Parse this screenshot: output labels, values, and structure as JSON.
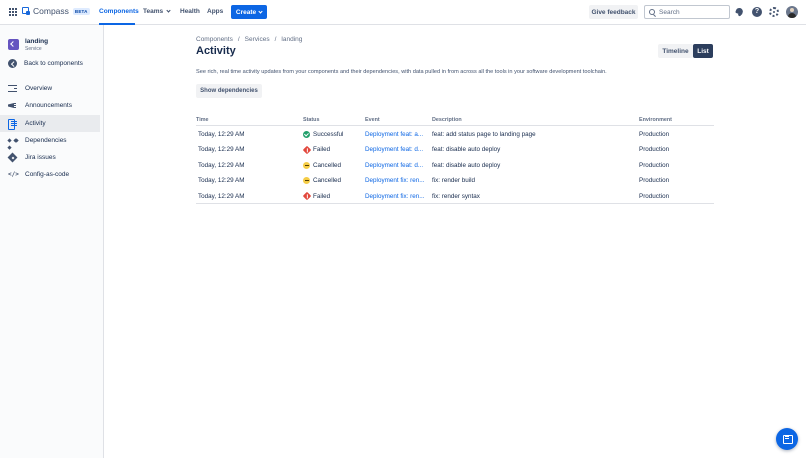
{
  "topnav": {
    "app_name": "Compass",
    "beta_badge": "BETA",
    "items": [
      {
        "label": "Components",
        "active": true
      },
      {
        "label": "Teams",
        "has_dropdown": true
      },
      {
        "label": "Health"
      },
      {
        "label": "Apps"
      }
    ],
    "create_label": "Create",
    "feedback_label": "Give feedback",
    "search_placeholder": "Search",
    "icons": [
      "apps-grid-icon",
      "notifications-bell-icon",
      "help-icon",
      "settings-gear-icon",
      "user-avatar"
    ]
  },
  "sidebar": {
    "component_name": "landing",
    "component_type": "Service",
    "back_label": "Back to components",
    "items": [
      {
        "label": "Overview",
        "icon": "overview-icon"
      },
      {
        "label": "Announcements",
        "icon": "megaphone-icon"
      },
      {
        "label": "Activity",
        "icon": "activity-icon",
        "active": true
      },
      {
        "label": "Dependencies",
        "icon": "dependencies-icon"
      },
      {
        "label": "Jira issues",
        "icon": "jira-icon"
      },
      {
        "label": "Config-as-code",
        "icon": "code-icon"
      }
    ]
  },
  "main": {
    "breadcrumbs": [
      "Components",
      "Services",
      "landing"
    ],
    "title": "Activity",
    "view_toggle": {
      "timeline": "Timeline",
      "list": "List",
      "selected": "List"
    },
    "description": "See rich, real time activity updates from your components and their dependencies, with data pulled in from across all the tools in your software development toolchain.",
    "show_dependencies_label": "Show dependencies",
    "table": {
      "headers": {
        "time": "Time",
        "status": "Status",
        "event": "Event",
        "description": "Description",
        "environment": "Environment"
      },
      "rows": [
        {
          "time": "Today, 12:29 AM",
          "status": "Successful",
          "status_type": "success",
          "event": "Deployment feat: a...",
          "description": "feat: add status page to landing page",
          "environment": "Production"
        },
        {
          "time": "Today, 12:29 AM",
          "status": "Failed",
          "status_type": "failed",
          "event": "Deployment feat: d...",
          "description": "feat: disable auto deploy",
          "environment": "Production"
        },
        {
          "time": "Today, 12:29 AM",
          "status": "Cancelled",
          "status_type": "cancelled",
          "event": "Deployment feat: d...",
          "description": "feat: disable auto deploy",
          "environment": "Production"
        },
        {
          "time": "Today, 12:29 AM",
          "status": "Cancelled",
          "status_type": "cancelled",
          "event": "Deployment fix: ren...",
          "description": "fix: render build",
          "environment": "Production"
        },
        {
          "time": "Today, 12:29 AM",
          "status": "Failed",
          "status_type": "failed",
          "event": "Deployment fix: ren...",
          "description": "fix: render syntax",
          "environment": "Production"
        }
      ]
    }
  },
  "colors": {
    "accent": "#0c66e4",
    "success": "#22a06b",
    "failed": "#e2483d",
    "cancelled": "#f5cd47",
    "toggle_selected": "#2c3e5d"
  },
  "fab_icon": "chat-feedback-icon"
}
